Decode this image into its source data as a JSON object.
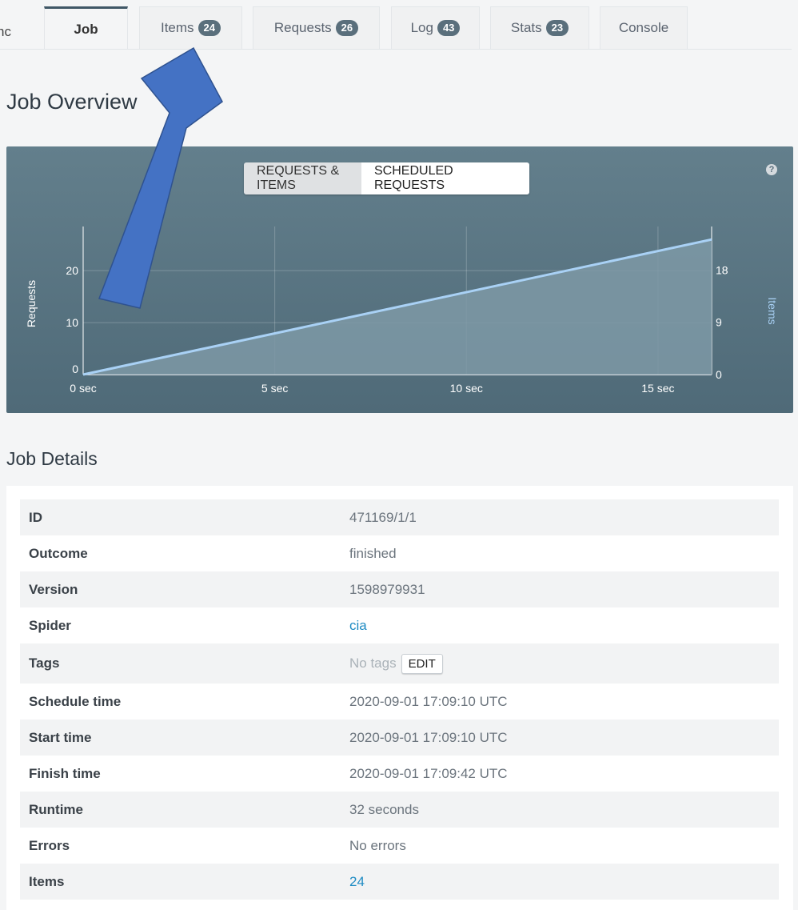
{
  "tabs": {
    "cut_label": "nc",
    "items": [
      {
        "label": "Job",
        "count": "",
        "active": true
      },
      {
        "label": "Items",
        "count": "24"
      },
      {
        "label": "Requests",
        "count": "26"
      },
      {
        "label": "Log",
        "count": "43"
      },
      {
        "label": "Stats",
        "count": "23"
      },
      {
        "label": "Console",
        "count": ""
      }
    ]
  },
  "overview": {
    "title": "Job Overview",
    "toggle": {
      "active": "REQUESTS & ITEMS",
      "inactive": "SCHEDULED REQUESTS"
    },
    "help": "?"
  },
  "chart_data": {
    "type": "area",
    "x_ticks": [
      "0 sec",
      "5 sec",
      "10 sec",
      "15 sec"
    ],
    "y_left_label": "Requests",
    "y_left_ticks": [
      "0",
      "10",
      "20"
    ],
    "y_right_label": "Items",
    "y_right_ticks": [
      "0",
      "9",
      "18"
    ],
    "x": [
      0,
      16.4
    ],
    "series": [
      {
        "axis": "left",
        "values": [
          0,
          26
        ]
      }
    ],
    "xlim": [
      0,
      16.4
    ],
    "ylim_left": [
      0,
      28.5
    ],
    "ylim_right": [
      0,
      25.5
    ],
    "grid": true,
    "colors": {
      "line": "#a9d1f5",
      "fill": "#7e99a6"
    }
  },
  "details": {
    "title": "Job Details",
    "rows": [
      {
        "key": "ID",
        "value": "471169/1/1"
      },
      {
        "key": "Outcome",
        "value": "finished"
      },
      {
        "key": "Version",
        "value": "1598979931"
      },
      {
        "key": "Spider",
        "value": "cia",
        "link": true
      },
      {
        "key": "Tags",
        "value": "No tags",
        "button": "EDIT"
      },
      {
        "key": "Schedule time",
        "value": "2020-09-01 17:09:10 UTC"
      },
      {
        "key": "Start time",
        "value": "2020-09-01 17:09:10 UTC"
      },
      {
        "key": "Finish time",
        "value": "2020-09-01 17:09:42 UTC"
      },
      {
        "key": "Runtime",
        "value": "32 seconds"
      },
      {
        "key": "Errors",
        "value": "No errors"
      },
      {
        "key": "Items",
        "value": "24",
        "link": true
      }
    ]
  },
  "annotation": {
    "color": "#4472c4"
  }
}
